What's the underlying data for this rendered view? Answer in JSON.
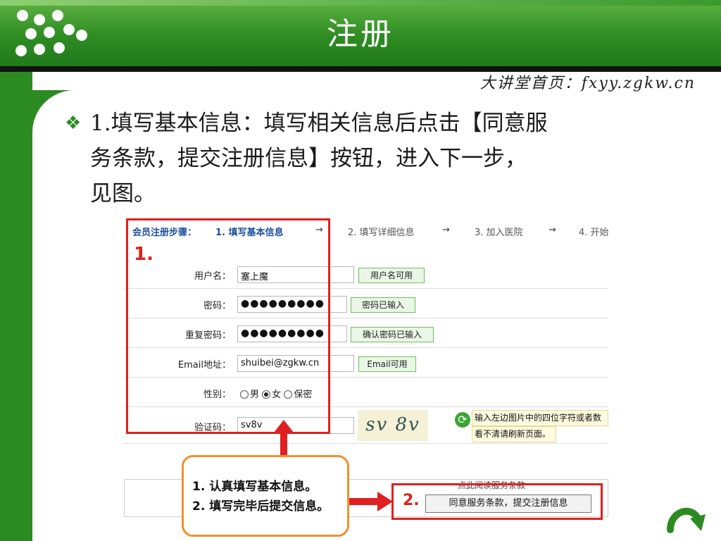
{
  "slide": {
    "title": "注册",
    "site_url": "大讲堂首页：fxyy.zgkw.cn",
    "bullet_line1": "1.填写基本信息：填写相关信息后点击【同意服",
    "bullet_line2": "务条款，提交注册信息】按钮，进入下一步，",
    "bullet_line3": "见图。"
  },
  "steps": {
    "lead": "会员注册步骤：",
    "step1": "1. 填写基本信息",
    "step2": "2. 填写详细信息",
    "step3": "3. 加入医院",
    "step4": "4. 开始",
    "arrow": "→"
  },
  "form": {
    "username_label": "用户名：",
    "username_value": "塞上魔",
    "username_status": "用户名可用",
    "password_label": "密码：",
    "password_value": "●●●●●●●●●",
    "password_status": "密码已输入",
    "repeat_label": "重复密码：",
    "repeat_value": "●●●●●●●●●",
    "repeat_status": "确认密码已输入",
    "email_label": "Email地址：",
    "email_value": "shuibei@zgkw.cn",
    "email_status": "Email可用",
    "gender_label": "性别：",
    "gender_options": [
      "男",
      "女",
      "保密"
    ],
    "gender_selected": "女",
    "captcha_label": "验证码：",
    "captcha_value": "sv8v",
    "captcha_image_text": "sv 8v",
    "captcha_hint_line1": "输入左边图片中的四位字符或者数",
    "captcha_hint_line2": "看不清请刷新页面。"
  },
  "annotations": {
    "marker1": "1.",
    "marker2": "2.",
    "callout_line1": "1. 认真填写基本信息。",
    "callout_line2": "2. 填写完毕后提交信息。"
  },
  "submit": {
    "read_terms": "点此阅读服务条款",
    "button": "同意服务条款，提交注册信息"
  },
  "colors": {
    "green": "#2c8a22",
    "red": "#e02020",
    "orange": "#f09030",
    "step_blue": "#1d4f9e"
  }
}
